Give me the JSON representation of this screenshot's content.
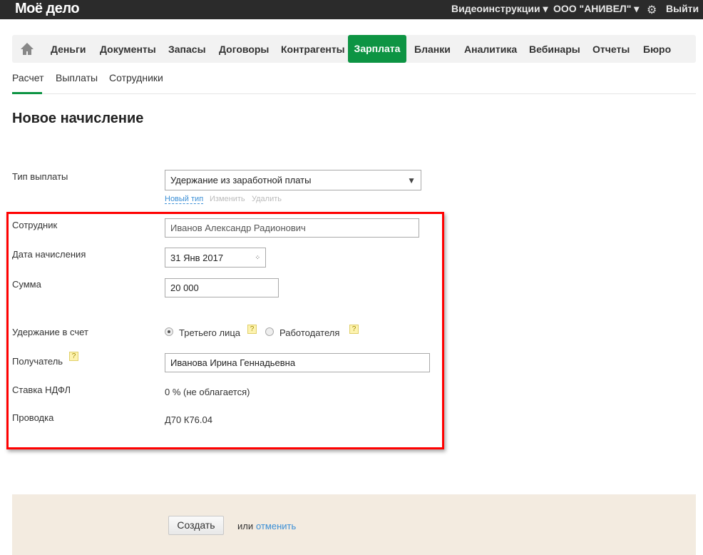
{
  "topbar": {
    "logo": "Моё дело",
    "video": "Видеоинструкции ▾",
    "org": "ООО \"АНИВЕЛ\" ▾",
    "logout": "Выйти"
  },
  "nav": {
    "items": [
      "Деньги",
      "Документы",
      "Запасы",
      "Договоры",
      "Контрагенты",
      "Зарплата",
      "Бланки",
      "Аналитика",
      "Вебинары",
      "Отчеты",
      "Бюро"
    ]
  },
  "subnav": {
    "items": [
      "Расчет",
      "Выплаты",
      "Сотрудники"
    ]
  },
  "page": {
    "title": "Новое начисление"
  },
  "form": {
    "pay_type_label": "Тип выплаты",
    "pay_type_value": "Удержание из заработной платы",
    "new_type": "Новый тип",
    "edit": "Изменить",
    "delete": "Удалить",
    "employee_label": "Сотрудник",
    "employee_value": "Иванов Александр Радионович",
    "date_label": "Дата начисления",
    "date_value": "31 Янв 2017",
    "sum_label": "Сумма",
    "sum_value": "20 000",
    "deduct_label": "Удержание в счет",
    "opt_third": "Третьего лица",
    "opt_employer": "Работодателя",
    "help": "?",
    "recipient_label": "Получатель",
    "recipient_value": "Иванова Ирина Геннадьевна",
    "ndfl_label": "Ставка НДФЛ",
    "ndfl_value": "0 % (не облагается)",
    "posting_label": "Проводка",
    "posting_value": "Д70 К76.04"
  },
  "footer": {
    "create": "Создать",
    "or": "или",
    "cancel": "отменить"
  }
}
